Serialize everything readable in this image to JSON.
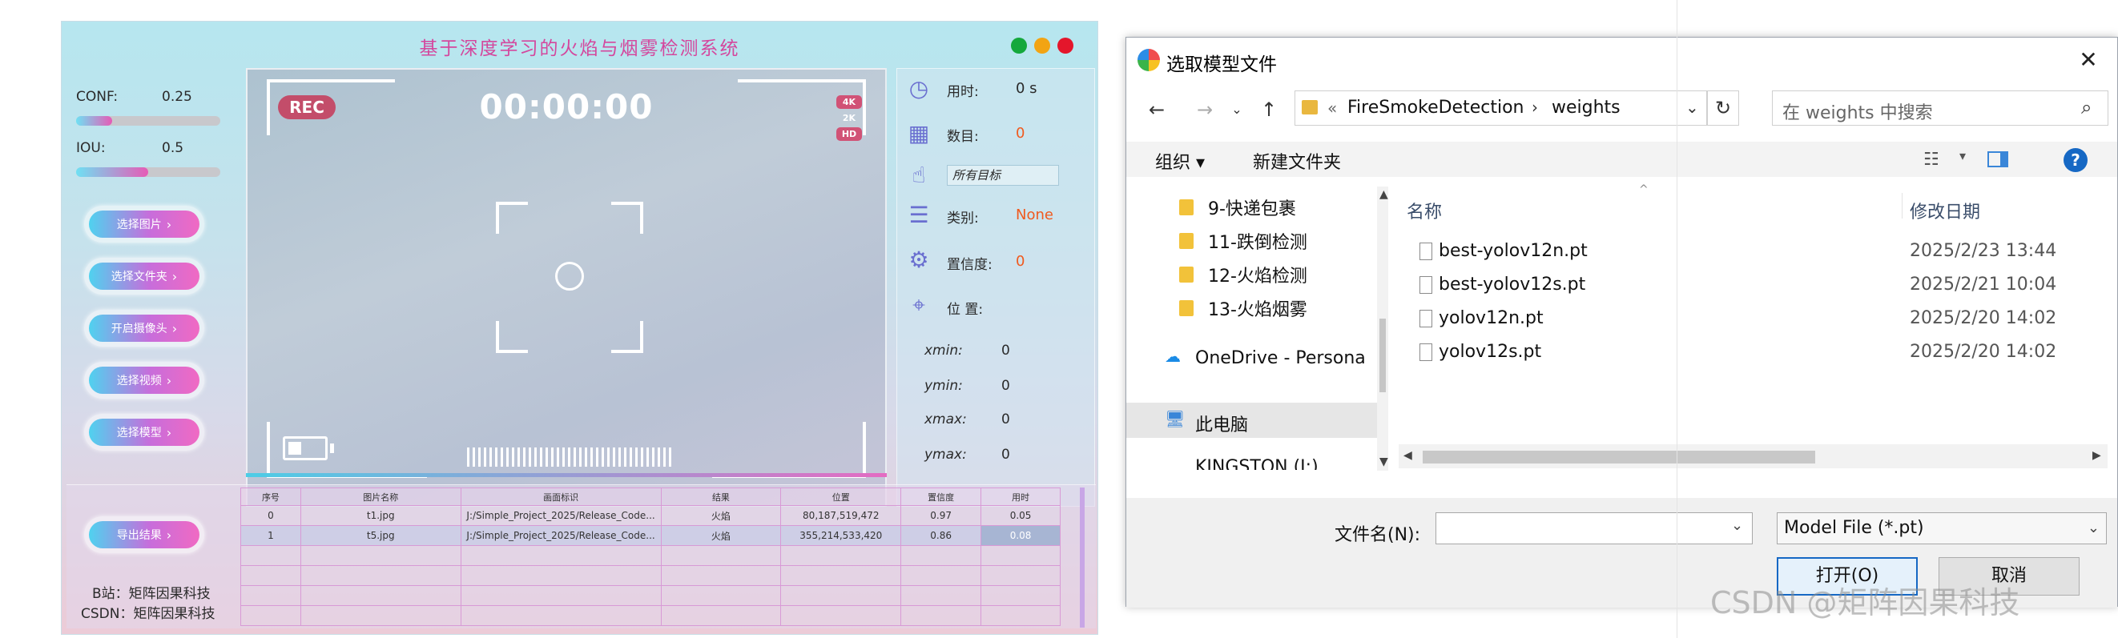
{
  "app": {
    "title": "基于深度学习的火焰与烟雾检测系统",
    "conf_label": "CONF:",
    "conf_value": "0.25",
    "iou_label": "IOU:",
    "iou_value": "0.5",
    "conf_slider_level": 0.25,
    "iou_slider_level": 0.5,
    "buttons": {
      "select_image": "选择图片",
      "select_folder": "选择文件夹",
      "open_camera": "开启摄像头",
      "select_video": "选择视频",
      "select_model": "选择模型",
      "export": "导出结果"
    },
    "video": {
      "rec": "REC",
      "timer": "00:00:00",
      "badge_4k": "4K",
      "badge_2k": "2K",
      "badge_hd": "HD"
    },
    "info": {
      "time_label": "用时:",
      "time_value": "0 s",
      "count_label": "数目:",
      "count_value": "0",
      "target_select": "所有目标",
      "class_label": "类别:",
      "class_value": "None",
      "confidence_label": "置信度:",
      "confidence_value": "0",
      "position_label": "位 置:",
      "xmin_label": "xmin:",
      "xmin_value": "0",
      "ymin_label": "ymin:",
      "ymin_value": "0",
      "xmax_label": "xmax:",
      "xmax_value": "0",
      "ymax_label": "ymax:",
      "ymax_value": "0"
    },
    "table": {
      "headers": [
        "序号",
        "图片名称",
        "画面标识",
        "结果",
        "位置",
        "置信度",
        "用时"
      ],
      "rows": [
        [
          "0",
          "t1.jpg",
          "J:/Simple_Project_2025/Release_Code...",
          "火焰",
          "80,187,519,472",
          "0.97",
          "0.05"
        ],
        [
          "1",
          "t5.jpg",
          "J:/Simple_Project_2025/Release_Code...",
          "火焰",
          "355,214,533,420",
          "0.86",
          "0.08"
        ]
      ]
    },
    "footer_bili": "B站：矩阵因果科技",
    "footer_csdn": "CSDN：矩阵因果科技"
  },
  "dialog": {
    "title": "选取模型文件",
    "address": {
      "part1": "FireSmokeDetection",
      "separator": "›",
      "part2": "weights"
    },
    "search_placeholder": "在 weights 中搜索",
    "toolbar": {
      "organize": "组织 ▾",
      "new_folder": "新建文件夹"
    },
    "nav_items": [
      "9-快递包裹",
      "11-跌倒检测",
      "12-火焰检测",
      "13-火焰烟雾",
      "OneDrive - Persona",
      "此电脑",
      "KINGSTON (J:)"
    ],
    "columns": {
      "name": "名称",
      "date": "修改日期"
    },
    "files": [
      {
        "name": "best-yolov12n.pt",
        "date": "2025/2/23 13:44"
      },
      {
        "name": "best-yolov12s.pt",
        "date": "2025/2/21 10:04"
      },
      {
        "name": "yolov12n.pt",
        "date": "2025/2/20 14:02"
      },
      {
        "name": "yolov12s.pt",
        "date": "2025/2/20 14:02"
      }
    ],
    "filename_label": "文件名(N):",
    "filename_value": "",
    "filter_value": "Model File (*.pt)",
    "open_button": "打开(O)",
    "cancel_button": "取消"
  },
  "watermark": "CSDN @矩阵因果科技",
  "colors": {
    "accent_pink": "#d4479d",
    "orange_value": "#f05a1e",
    "windows_blue": "#1668c4"
  }
}
